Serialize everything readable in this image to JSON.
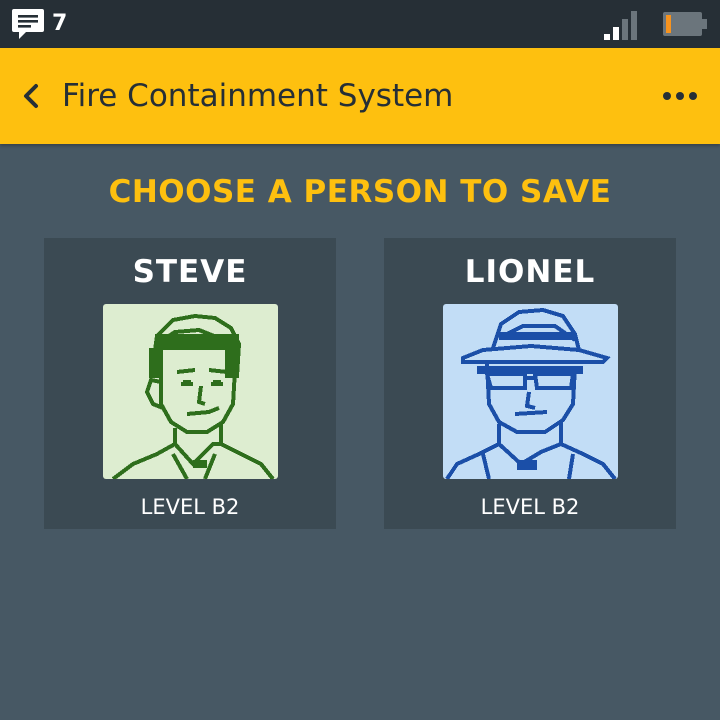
{
  "status_bar": {
    "message_count": "7",
    "icons": [
      "message-icon",
      "signal-icon",
      "battery-icon"
    ],
    "battery_color": "#f7931e"
  },
  "app_bar": {
    "title": "Fire Containment System",
    "back_icon": "chevron-left-icon",
    "more_icon": "more-dots-icon",
    "color": "#fec00f"
  },
  "main": {
    "heading": "CHOOSE A PERSON TO SAVE",
    "people": [
      {
        "name": "STEVE",
        "level": "LEVEL B2",
        "portrait": "steve-portrait",
        "portrait_color": "#2e6e1c"
      },
      {
        "name": "LIONEL",
        "level": "LEVEL B2",
        "portrait": "lionel-portrait",
        "portrait_color": "#1b4fa8"
      }
    ]
  }
}
